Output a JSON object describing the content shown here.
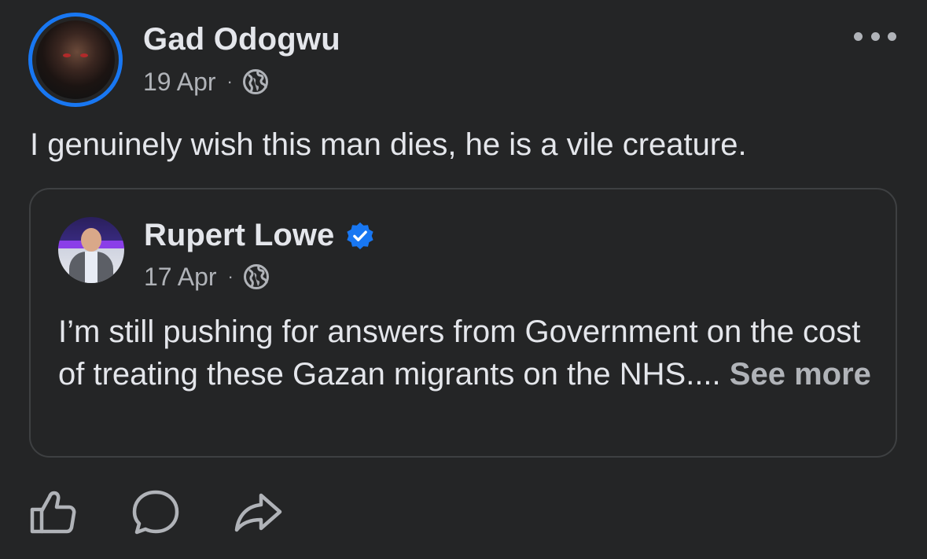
{
  "post": {
    "author": "Gad Odogwu",
    "date": "19 Apr",
    "separator": "·",
    "audience_icon": "globe-icon",
    "more_icon": "more-options-icon",
    "text": "I genuinely wish this man dies, he is a vile creature."
  },
  "shared_post": {
    "author": "Rupert Lowe",
    "verified_icon": "verified-badge-icon",
    "date": "17 Apr",
    "separator": "·",
    "audience_icon": "globe-icon",
    "text": "I’m still pushing for answers from Government on the cost of treating these Gazan migrants on the NHS....",
    "see_more": "See more"
  },
  "actions": [
    {
      "name": "like",
      "icon": "thumbs-up-icon"
    },
    {
      "name": "comment",
      "icon": "comment-bubble-icon"
    },
    {
      "name": "share",
      "icon": "share-arrow-icon"
    }
  ],
  "colors": {
    "background": "#242526",
    "primary_text": "#e4e6eb",
    "secondary_text": "#b0b3b8",
    "accent": "#1877f2",
    "border": "#3e4042"
  }
}
